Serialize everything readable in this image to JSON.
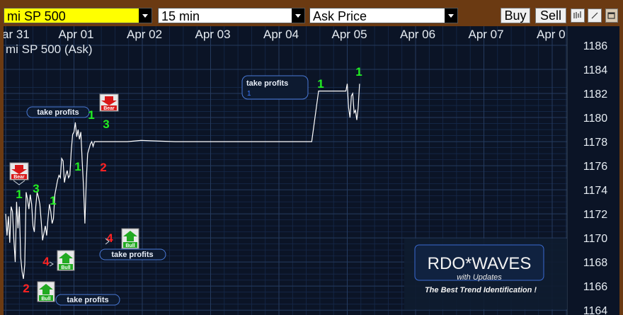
{
  "toolbar": {
    "symbol": "mi SP 500",
    "interval": "15 min",
    "price_type": "Ask Price",
    "buy_label": "Buy",
    "sell_label": "Sell",
    "icons": [
      "bar-chart-icon",
      "line-tool-icon",
      "window-icon"
    ]
  },
  "chart_data": {
    "type": "line",
    "title": "mi SP 500 (Ask)",
    "x_tick_labels": [
      "ar 31",
      "Apr 01",
      "Apr 02",
      "Apr 03",
      "Apr 04",
      "Apr 05",
      "Apr 06",
      "Apr 07",
      "Apr 0"
    ],
    "y_tick_labels": [
      "1164",
      "1166",
      "1168",
      "1170",
      "1172",
      "1174",
      "1176",
      "1178",
      "1180",
      "1182",
      "1184",
      "1186"
    ],
    "y_ticks": [
      1164,
      1166,
      1168,
      1170,
      1172,
      1174,
      1176,
      1178,
      1180,
      1182,
      1184,
      1186
    ],
    "ylim": [
      1163.6,
      1187.0
    ],
    "xlim": [
      0.02,
      8.6
    ],
    "grid": true,
    "series": [
      {
        "x": [
          0.02,
          0.04,
          0.06,
          0.08,
          0.1,
          0.12,
          0.14,
          0.16,
          0.18,
          0.2,
          0.22,
          0.24,
          0.26,
          0.28,
          0.3,
          0.32,
          0.34,
          0.36,
          0.38,
          0.4,
          0.42,
          0.44,
          0.46,
          0.48,
          0.5,
          0.52,
          0.54,
          0.56,
          0.58,
          0.6,
          0.62,
          0.64,
          0.66,
          0.68,
          0.7,
          0.72,
          0.74,
          0.76,
          0.78,
          0.8,
          0.82,
          0.84,
          0.86,
          0.88,
          0.9,
          0.92,
          0.94,
          0.96,
          0.98,
          1.0,
          1.02,
          1.04,
          1.06,
          1.08,
          1.1,
          1.12,
          1.14,
          1.16,
          1.18,
          1.2,
          1.22,
          1.24,
          1.26,
          1.28,
          1.3,
          1.32,
          1.34,
          1.36,
          1.38,
          1.4,
          1.42,
          1.44,
          1.46,
          1.48,
          1.5,
          1.52,
          1.54,
          1.56,
          1.58,
          1.6,
          1.7,
          1.8,
          2.0,
          2.5,
          3.0,
          3.5,
          4.0,
          4.2,
          4.4,
          4.5,
          4.6,
          4.8,
          5.0,
          5.02,
          5.04,
          5.06,
          5.08,
          5.1,
          5.12,
          5.14,
          5.16,
          5.18,
          5.2
        ],
        "y": [
          1172.0,
          1170.2,
          1171.8,
          1169.6,
          1172.6,
          1172.2,
          1169.8,
          1168.0,
          1173.0,
          1170.8,
          1172.6,
          1168.4,
          1167.2,
          1166.6,
          1167.8,
          1173.8,
          1173.2,
          1172.4,
          1173.6,
          1172.8,
          1171.0,
          1170.5,
          1172.6,
          1173.8,
          1173.4,
          1172.8,
          1171.4,
          1169.8,
          1170.4,
          1171.0,
          1170.2,
          1171.6,
          1172.8,
          1172.2,
          1171.2,
          1171.6,
          1173.6,
          1174.2,
          1174.8,
          1175.2,
          1175.0,
          1176.6,
          1176.4,
          1174.6,
          1175.2,
          1175.6,
          1175.0,
          1175.2,
          1177.2,
          1178.6,
          1178.8,
          1179.6,
          1178.4,
          1179.0,
          1178.2,
          1178.8,
          1176.4,
          1174.2,
          1171.2,
          1174.8,
          1177.0,
          1177.4,
          1177.8,
          1178.0,
          1177.6,
          1178.0,
          1178.0,
          1178.0,
          1178.0,
          1178.0,
          1178.0,
          1178.0,
          1178.0,
          1178.0,
          1178.0,
          1178.0,
          1178.0,
          1178.0,
          1178.0,
          1178.0,
          1178.0,
          1178.0,
          1178.1,
          1178.0,
          1178.0,
          1178.0,
          1178.0,
          1178.0,
          1178.0,
          1178.0,
          1182.2,
          1182.2,
          1182.2,
          1182.8,
          1180.8,
          1180.0,
          1181.8,
          1182.0,
          1180.4,
          1180.6,
          1179.8,
          1180.8,
          1182.8
        ]
      }
    ]
  },
  "annotations": {
    "labels": [
      "1",
      "3",
      "1",
      "1",
      "2",
      "1",
      "3",
      "4",
      "2",
      "4",
      "1",
      "1"
    ],
    "take_profits": [
      "take profits",
      "take profits",
      "take profits",
      "take profits"
    ],
    "take_profits_sub": "1",
    "bear_label": "Bear",
    "bull_label": "Bull",
    "colors": {
      "green": "#22ee22",
      "red": "#ff2222",
      "line": "#ffffff",
      "grid": "#1e3552",
      "background": "#0b1426"
    }
  },
  "logo": {
    "title": "RDO*WAVES",
    "subtitle": "with Updates",
    "tagline": "The Best Trend Identification !"
  }
}
